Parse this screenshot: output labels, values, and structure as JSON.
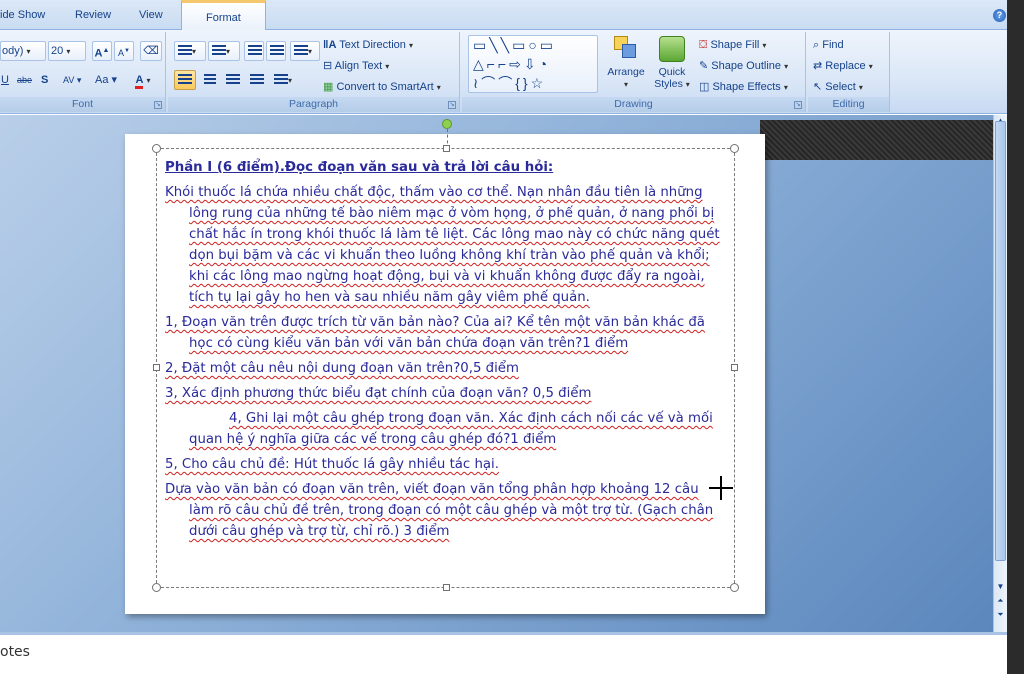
{
  "tabs": [
    "ide Show",
    "Review",
    "View",
    "Format"
  ],
  "ribbon": {
    "font": {
      "font_name": "ody)",
      "font_size": "20",
      "label": "Font"
    },
    "paragraph": {
      "text_direction": "Text Direction",
      "align_text": "Align Text",
      "convert_smartart": "Convert to SmartArt",
      "label": "Paragraph"
    },
    "drawing": {
      "arrange": "Arrange",
      "quick_styles": "Quick Styles",
      "shape_fill": "Shape Fill",
      "shape_outline": "Shape Outline",
      "shape_effects": "Shape Effects",
      "label": "Drawing"
    },
    "editing": {
      "find": "Find",
      "replace": "Replace",
      "select": "Select",
      "label": "Editing"
    }
  },
  "slide": {
    "title": "Phần I (6 điểm).Đọc đoạn văn sau và trả lời câu hỏi:",
    "paragraphs": [
      "Khói thuốc lá chứa nhiều chất độc, thấm vào cơ thể. Nạn nhân đầu tiên là những lông rung của những tế bào niêm mạc ở vòm họng, ở phế quản, ở nang phổi bị chất hắc ín trong khói thuốc lá làm tê liệt. Các lông mao này có chức năng quét dọn bụi bặm và các vi khuẩn theo luồng không khí tràn vào phế quản và khổi; khi các lông mao ngừng hoạt động, bụi và vi khuẩn không được đẩy ra ngoài, tích tụ lại gây ho hen và sau nhiều năm gây viêm phế quản.",
      "1, Đoạn văn trên được trích từ văn bản nào? Của ai? Kể tên một văn bản khác đã học có cùng kiểu văn bản với văn bản chứa đoạn văn trên?1 điểm",
      "2, Đặt một câu nêu nội dung đoạn văn trên?0,5 điểm",
      "3, Xác định phương thức biểu đạt chính của đoạn văn? 0,5 điểm",
      "4, Ghi lại một câu ghép trong đoạn văn. Xác định cách nối các vế và mối quan hệ ý nghĩa giữa các vế trong câu ghép đó?1 điểm",
      "5, Cho câu chủ đề: Hút thuốc lá gây nhiều tác hại.",
      "Dựa vào văn bản có đoạn văn trên, viết đoạn văn tổng phân hợp khoảng 12 câu làm rõ câu chủ đề trên, trong đoạn có một câu ghép và một trợ từ. (Gạch chân dưới câu ghép và trợ từ, chỉ rõ.) 3 điểm"
    ]
  },
  "notes": "otes"
}
